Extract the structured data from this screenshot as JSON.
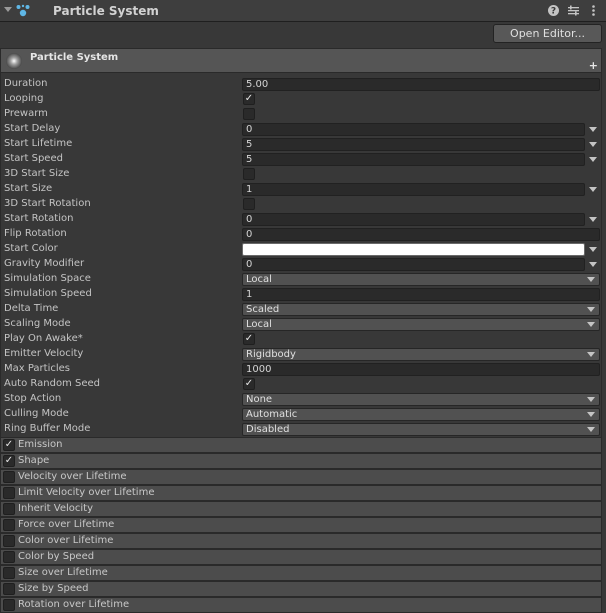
{
  "component": {
    "title": "Particle System",
    "ps_icon": "particle-system-icon",
    "help_icon": "help-icon",
    "presets_icon": "presets-icon",
    "menu_icon": "kebab-menu-icon"
  },
  "open_editor_label": "Open Editor...",
  "main_module": {
    "label": "Particle System",
    "plus": "+"
  },
  "properties": [
    {
      "label": "Duration",
      "type": "field",
      "value": "5.00"
    },
    {
      "label": "Looping",
      "type": "check",
      "checked": true
    },
    {
      "label": "Prewarm",
      "type": "check",
      "checked": false
    },
    {
      "label": "Start Delay",
      "type": "curve",
      "value": "0"
    },
    {
      "label": "Start Lifetime",
      "type": "curve",
      "value": "5"
    },
    {
      "label": "Start Speed",
      "type": "curve",
      "value": "5"
    },
    {
      "label": "3D Start Size",
      "type": "check",
      "checked": false
    },
    {
      "label": "Start Size",
      "type": "curve",
      "value": "1"
    },
    {
      "label": "3D Start Rotation",
      "type": "check",
      "checked": false
    },
    {
      "label": "Start Rotation",
      "type": "curve",
      "value": "0"
    },
    {
      "label": "Flip Rotation",
      "type": "field",
      "value": "0"
    },
    {
      "label": "Start Color",
      "type": "color",
      "value": "#ffffff"
    },
    {
      "label": "Gravity Modifier",
      "type": "curve",
      "value": "0"
    },
    {
      "label": "Simulation Space",
      "type": "dropdown",
      "value": "Local"
    },
    {
      "label": "Simulation Speed",
      "type": "field",
      "value": "1"
    },
    {
      "label": "Delta Time",
      "type": "dropdown",
      "value": "Scaled"
    },
    {
      "label": "Scaling Mode",
      "type": "dropdown",
      "value": "Local"
    },
    {
      "label": "Play On Awake*",
      "type": "check",
      "checked": true
    },
    {
      "label": "Emitter Velocity",
      "type": "dropdown",
      "value": "Rigidbody"
    },
    {
      "label": "Max Particles",
      "type": "field",
      "value": "1000"
    },
    {
      "label": "Auto Random Seed",
      "type": "check",
      "checked": true
    },
    {
      "label": "Stop Action",
      "type": "dropdown",
      "value": "None"
    },
    {
      "label": "Culling Mode",
      "type": "dropdown",
      "value": "Automatic"
    },
    {
      "label": "Ring Buffer Mode",
      "type": "dropdown",
      "value": "Disabled"
    }
  ],
  "modules": [
    {
      "label": "Emission",
      "enabled": true
    },
    {
      "label": "Shape",
      "enabled": true
    },
    {
      "label": "Velocity over Lifetime",
      "enabled": false
    },
    {
      "label": "Limit Velocity over Lifetime",
      "enabled": false
    },
    {
      "label": "Inherit Velocity",
      "enabled": false
    },
    {
      "label": "Force over Lifetime",
      "enabled": false
    },
    {
      "label": "Color over Lifetime",
      "enabled": false
    },
    {
      "label": "Color by Speed",
      "enabled": false
    },
    {
      "label": "Size over Lifetime",
      "enabled": false
    },
    {
      "label": "Size by Speed",
      "enabled": false
    },
    {
      "label": "Rotation over Lifetime",
      "enabled": false
    }
  ],
  "check_glyph": "✓"
}
